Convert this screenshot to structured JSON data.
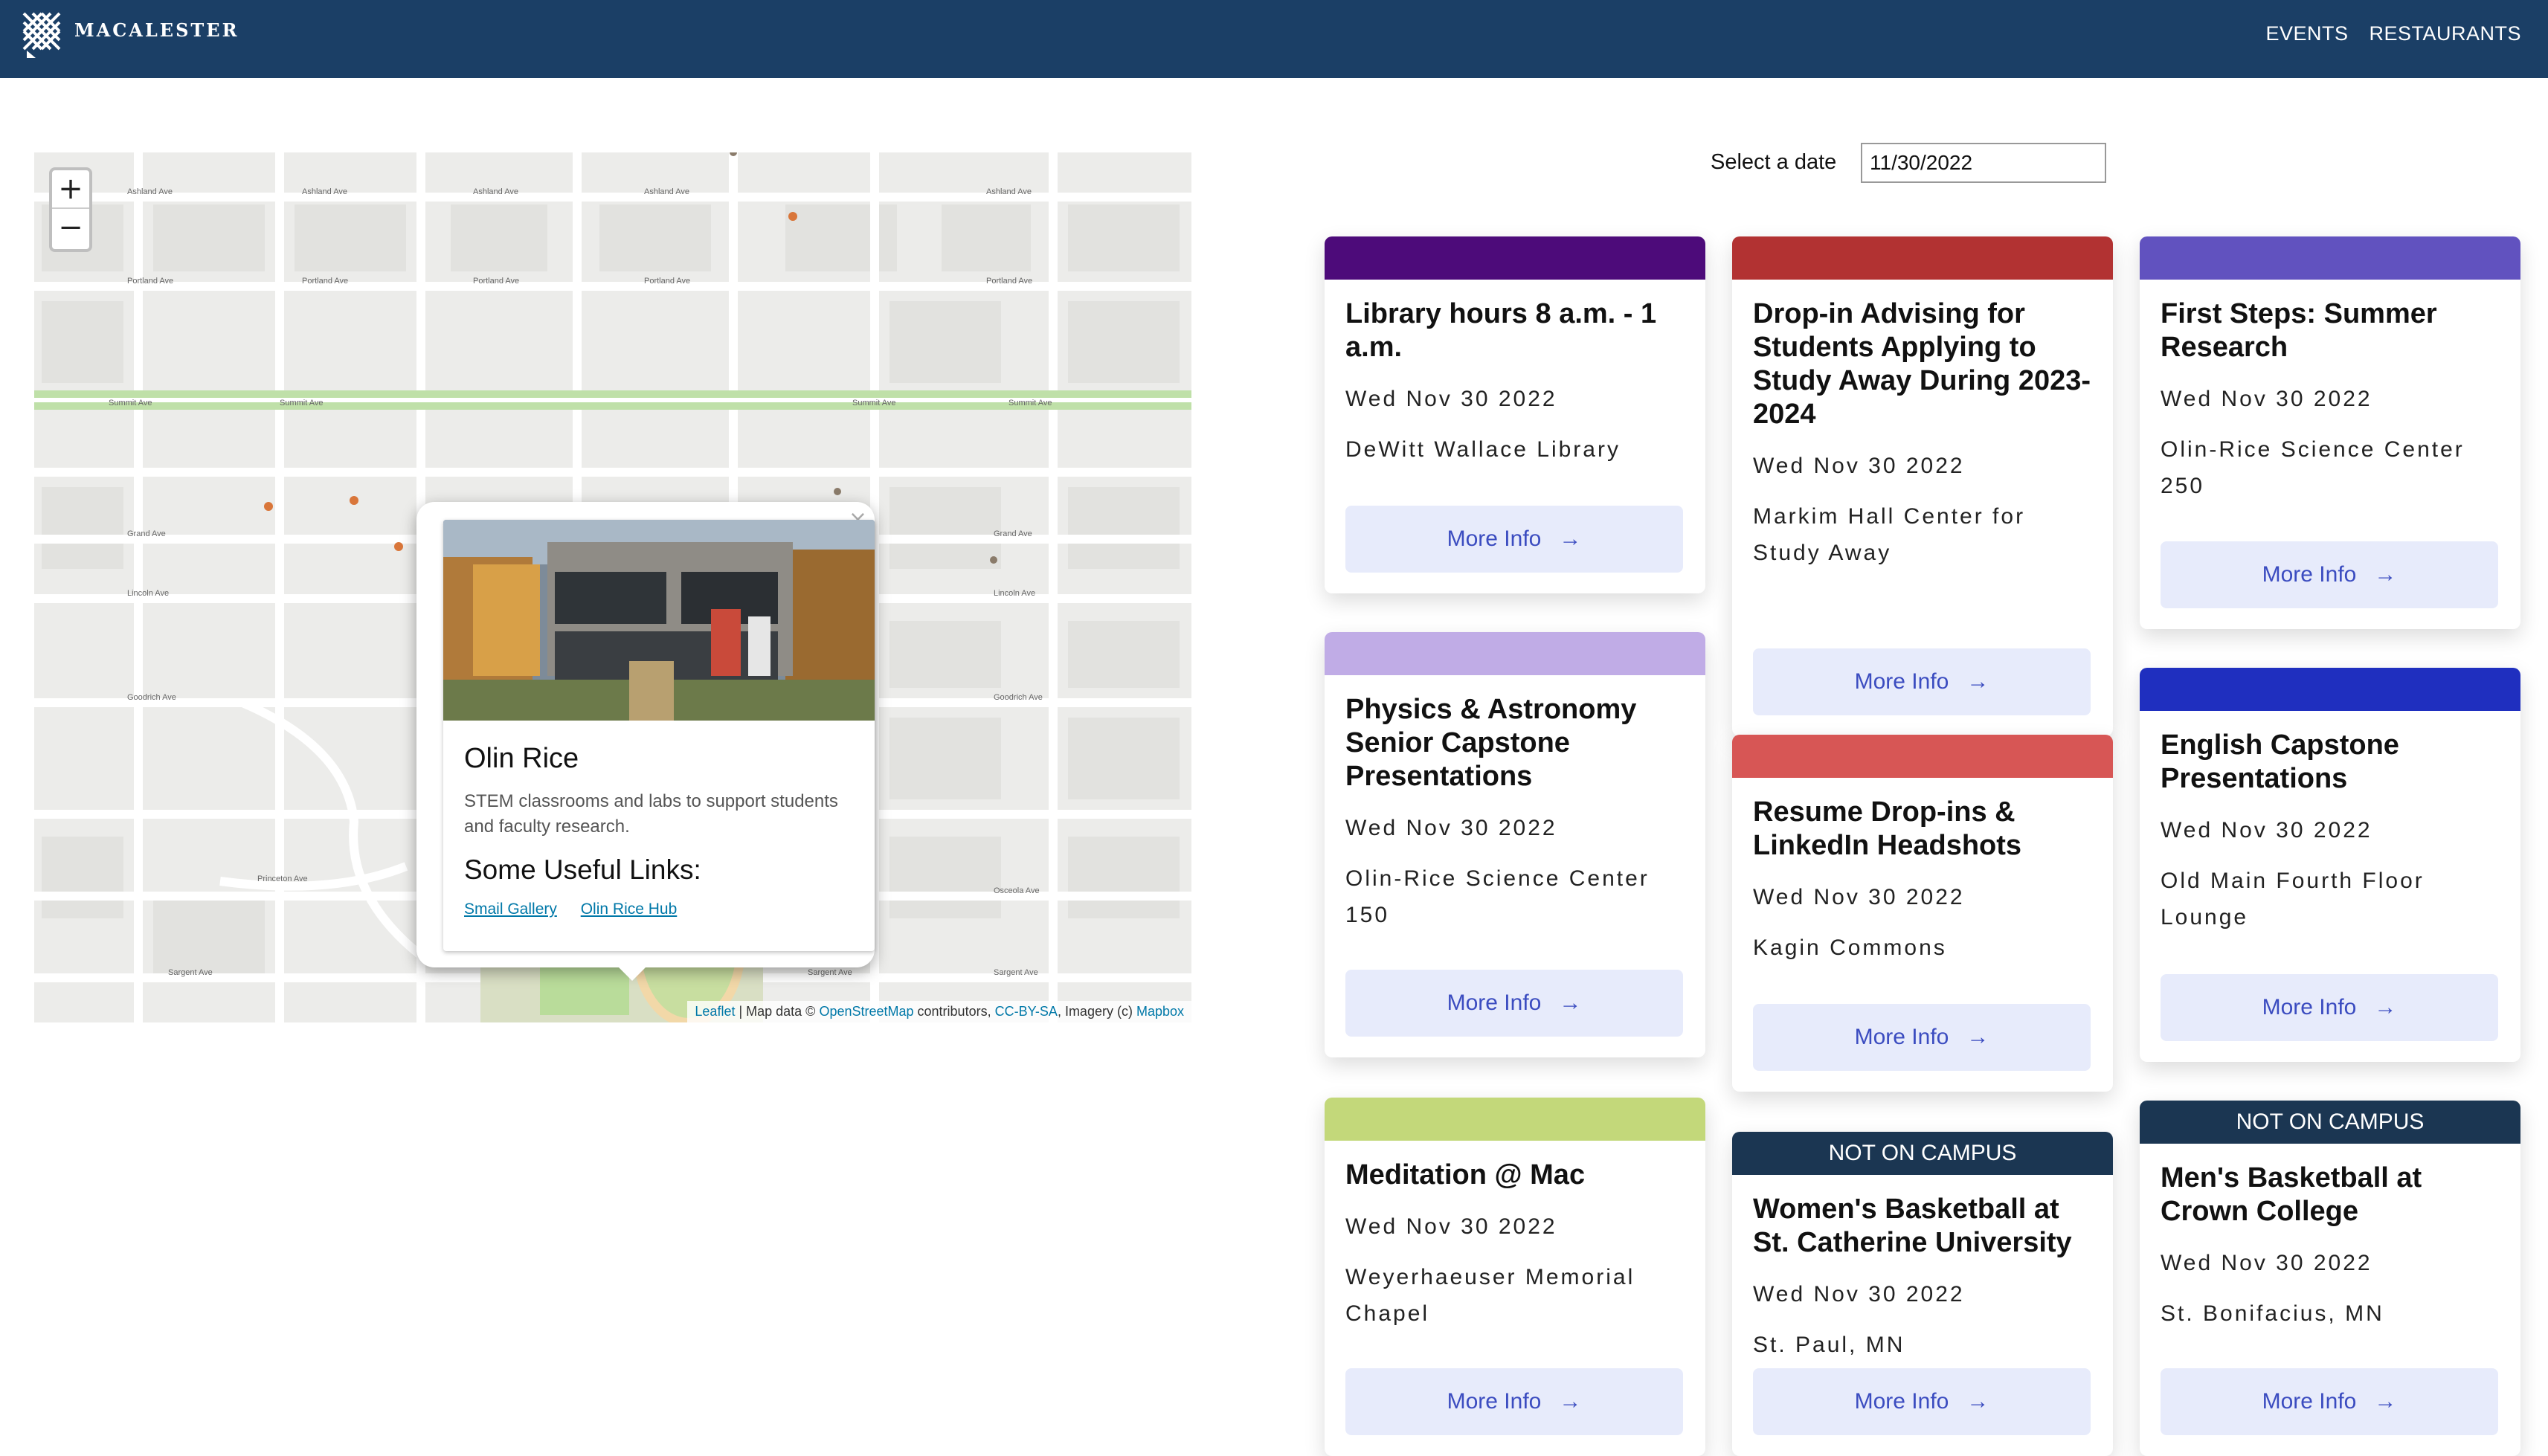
{
  "header": {
    "brand": "MACALESTER",
    "nav": [
      "EVENTS",
      "RESTAURANTS"
    ]
  },
  "map": {
    "zoom_in": "+",
    "zoom_out": "−",
    "attribution": {
      "leaflet": "Leaflet",
      "sep1": " | Map data © ",
      "osm": "OpenStreetMap",
      "mid": " contributors, ",
      "license": "CC-BY-SA",
      "mid2": ", Imagery (c) ",
      "mapbox": "Mapbox"
    },
    "popup": {
      "close": "×",
      "title": "Olin Rice",
      "description": "STEM classrooms and labs to support students and faculty research.",
      "links_title": "Some Useful Links:",
      "links": [
        "Smail Gallery",
        "Olin Rice Hub"
      ]
    }
  },
  "date_picker": {
    "label": "Select a date",
    "value": "11/30/2022"
  },
  "events": [
    {
      "band_color": "#4d0b7a",
      "band_text": "",
      "title": "Library hours 8 a.m. - 1 a.m.",
      "date": "Wed Nov 30 2022",
      "location": "DeWitt Wallace Library",
      "button": "More Info",
      "arrow": "→"
    },
    {
      "band_color": "#c0ace6",
      "band_text": "",
      "title": "Physics & Astronomy Senior Capstone Presentations",
      "date": "Wed Nov 30 2022",
      "location": "Olin-Rice Science Center 150",
      "button": "More Info",
      "arrow": "→"
    },
    {
      "band_color": "#c3d87a",
      "band_text": "",
      "title": "Meditation @ Mac",
      "date": "Wed Nov 30 2022",
      "location": "Weyerhaeuser Memorial Chapel",
      "button": "More Info",
      "arrow": "→"
    },
    {
      "band_color": "#b23232",
      "band_text": "",
      "title": "Drop-in Advising for Students Applying to Study Away During 2023-2024",
      "date": "Wed Nov 30 2022",
      "location": "Markim Hall Center for Study Away",
      "button": "More Info",
      "arrow": "→"
    },
    {
      "band_color": "#d75655",
      "band_text": "",
      "title": "Resume Drop-ins & LinkedIn Headshots",
      "date": "Wed Nov 30 2022",
      "location": "Kagin Commons",
      "button": "More Info",
      "arrow": "→"
    },
    {
      "band_color": "#1b3652",
      "band_text": "NOT ON CAMPUS",
      "title": "Women's Basketball at St. Catherine University",
      "date": "Wed Nov 30 2022",
      "location": "St. Paul, MN",
      "button": "More Info",
      "arrow": "→"
    },
    {
      "band_color": "#6152bf",
      "band_text": "",
      "title": "First Steps: Summer Research",
      "date": "Wed Nov 30 2022",
      "location": "Olin-Rice Science Center 250",
      "button": "More Info",
      "arrow": "→"
    },
    {
      "band_color": "#1f2fbf",
      "band_text": "",
      "title": "English Capstone Presentations",
      "date": "Wed Nov 30 2022",
      "location": "Old Main Fourth Floor Lounge",
      "button": "More Info",
      "arrow": "→"
    },
    {
      "band_color": "#1b3652",
      "band_text": "NOT ON CAMPUS",
      "title": "Men's Basketball at Crown College",
      "date": "Wed Nov 30 2022",
      "location": "St. Bonifacius, MN",
      "button": "More Info",
      "arrow": "→"
    }
  ]
}
